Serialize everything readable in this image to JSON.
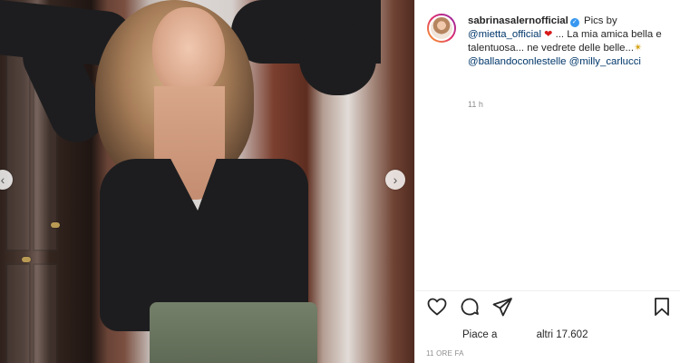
{
  "post": {
    "username": "sabrinasalernofficial",
    "caption": {
      "lead": "Pics by",
      "mention_photographer": "@mietta_official",
      "text_after_heart": "... La mia amica bella e talentuosa... ne vedrete delle belle...",
      "mention_show": "@ballandoconlestelle",
      "mention_host": "@milly_carlucci"
    },
    "caption_time": "11 h",
    "likes_text": "Piace a",
    "likes_count_text": "altri 17.602",
    "post_time": "11 ORE FA"
  },
  "icons": {
    "verified": "verified-badge-icon",
    "heart_emoji": "red-heart-emoji-icon",
    "sparkle_emoji": "dizzy-star-emoji-icon",
    "like": "heart-outline-icon",
    "comment": "speech-bubble-icon",
    "share": "paper-plane-icon",
    "save": "bookmark-icon",
    "prev": "chevron-left-icon",
    "next": "chevron-right-icon"
  },
  "colors": {
    "link": "#00376b",
    "verified": "#3897f0",
    "muted": "#8e8e8e",
    "text": "#262626"
  }
}
